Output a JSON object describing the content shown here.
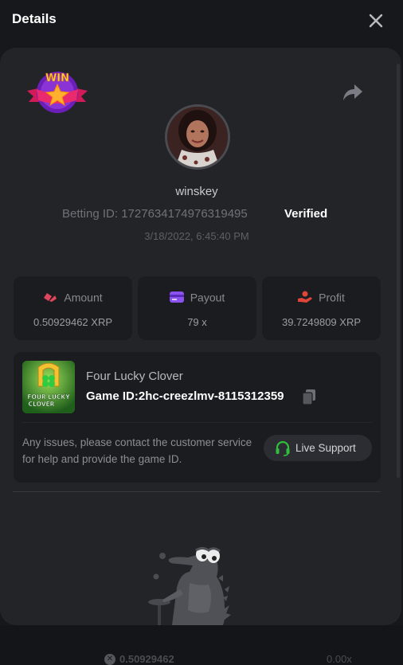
{
  "header": {
    "title": "Details"
  },
  "player": {
    "username": "winskey",
    "betting_id_label": "Betting ID:",
    "betting_id": "1727634174976319495",
    "verified": "Verified",
    "timestamp": "3/18/2022, 6:45:40 PM"
  },
  "badge": {
    "text": "WIN"
  },
  "stats": [
    {
      "label": "Amount",
      "value": "0.50929462 XRP",
      "icon": "amount-icon",
      "color": "#e0455d"
    },
    {
      "label": "Payout",
      "value": "79 x",
      "icon": "payout-card-icon",
      "color": "#8b52f0"
    },
    {
      "label": "Profit",
      "value": "39.7249809 XRP",
      "icon": "profit-hand-icon",
      "color": "#e0453a"
    }
  ],
  "game": {
    "name": "Four Lucky Clover",
    "id_label": "Game ID:",
    "id_value": "2hc-creezlmv-8115312359",
    "thumb_text_1": "FOUR LUCKY",
    "thumb_text_2": "CLOVER",
    "help_text": "Any issues, please contact the customer service for help and provide the game ID.",
    "support_label": "Live Support"
  },
  "background_row": {
    "amount": "0.50929462",
    "multiplier": "0.00x"
  },
  "colors": {
    "accent_green": "#2fbf3a",
    "panel": "#232428",
    "card": "#1b1c1f"
  }
}
